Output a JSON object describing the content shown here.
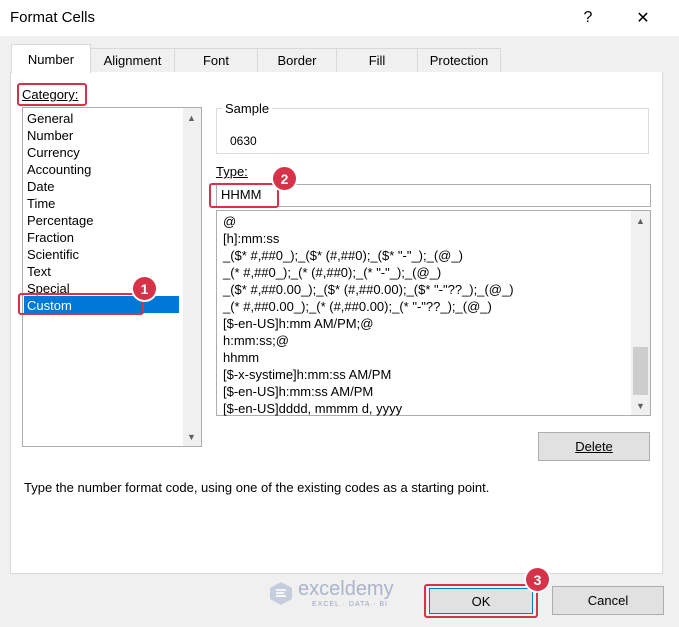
{
  "window": {
    "title": "Format Cells",
    "help_label": "?",
    "close_label": "✕"
  },
  "tabs": [
    {
      "label": "Number",
      "active": true
    },
    {
      "label": "Alignment",
      "active": false
    },
    {
      "label": "Font",
      "active": false
    },
    {
      "label": "Border",
      "active": false
    },
    {
      "label": "Fill",
      "active": false
    },
    {
      "label": "Protection",
      "active": false
    }
  ],
  "category": {
    "label": "Category:",
    "items": [
      "General",
      "Number",
      "Currency",
      "Accounting",
      "Date",
      "Time",
      "Percentage",
      "Fraction",
      "Scientific",
      "Text",
      "Special",
      "Custom"
    ],
    "selected": "Custom"
  },
  "sample": {
    "label": "Sample",
    "value": "0630"
  },
  "type": {
    "label": "Type:",
    "value": "HHMM",
    "formats": [
      "@",
      "[h]:mm:ss",
      "_($* #,##0_);_($* (#,##0);_($* \"-\"_);_(@_)",
      "_(* #,##0_);_(* (#,##0);_(* \"-\"_);_(@_)",
      "_($* #,##0.00_);_($* (#,##0.00);_($* \"-\"??_);_(@_)",
      "_(* #,##0.00_);_(* (#,##0.00);_(* \"-\"??_);_(@_)",
      "[$-en-US]h:mm AM/PM;@",
      "h:mm:ss;@",
      "hhmm",
      "[$-x-systime]h:mm:ss AM/PM",
      "[$-en-US]h:mm:ss AM/PM",
      "[$-en-US]dddd, mmmm d, yyyy"
    ]
  },
  "buttons": {
    "delete": "Delete",
    "ok": "OK",
    "cancel": "Cancel"
  },
  "description": "Type the number format code, using one of the existing codes as a starting point.",
  "badges": [
    "1",
    "2",
    "3"
  ],
  "watermark": {
    "name": "exceldemy",
    "tagline": "EXCEL · DATA · BI"
  },
  "colors": {
    "accent_selection": "#0078d7",
    "highlight": "#d6334a",
    "scroll_thumb": "#cdcdcd"
  }
}
